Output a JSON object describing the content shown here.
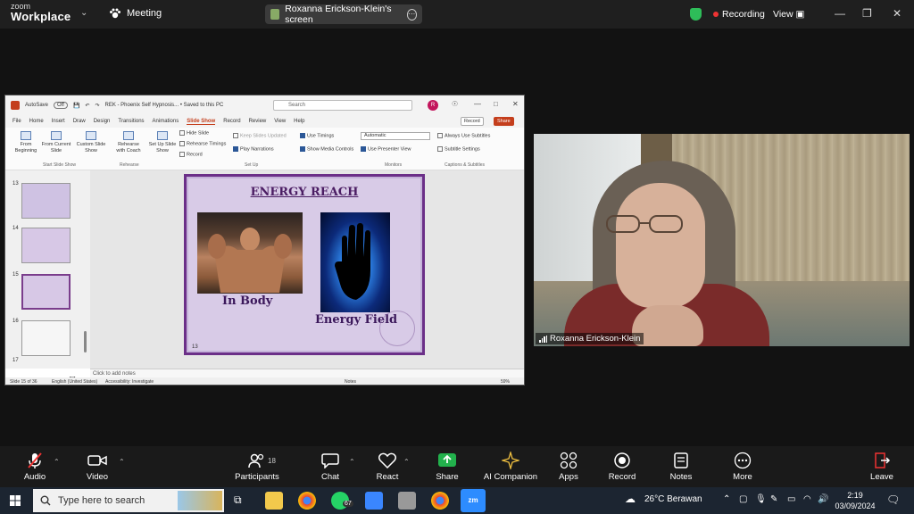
{
  "app": {
    "brand_line1": "zoom",
    "brand_line2": "Workplace",
    "meeting_label": "Meeting"
  },
  "share_pill": {
    "label": "Roxanna Erickson-Klein's screen"
  },
  "status": {
    "recording": "Recording",
    "view": "View"
  },
  "ppt": {
    "autosave": "AutoSave",
    "autosave_state": "Off",
    "doc_title": "REK - Phoenix Self Hypnosis... • Saved to this PC",
    "search_placeholder": "Search",
    "user_initial": "R",
    "menu": [
      "File",
      "Home",
      "Insert",
      "Draw",
      "Design",
      "Transitions",
      "Animations",
      "Slide Show",
      "Record",
      "Review",
      "View",
      "Help"
    ],
    "active_menu": "Slide Show",
    "record_btn": "Record",
    "share_btn": "Share",
    "ribbon": {
      "from_beginning": "From Beginning",
      "from_current": "From Current Slide",
      "custom_show": "Custom Slide Show",
      "rehearse_coach": "Rehearse with Coach",
      "setup_show": "Set Up Slide Show",
      "hide_slide": "Hide Slide",
      "rehearse_timings": "Rehearse Timings",
      "record": "Record",
      "play_from_start": "Keep Slides Updated",
      "play_narrations": "Play Narrations",
      "use_timings": "Use Timings",
      "show_media": "Show Media Controls",
      "monitor": "Automatic",
      "presenter_view": "Use Presenter View",
      "always_subtitles": "Always Use Subtitles",
      "subtitle_settings": "Subtitle Settings",
      "grp_start": "Start Slide Show",
      "grp_rehearse": "Rehearse",
      "grp_setup": "Set Up",
      "grp_monitors": "Monitors",
      "grp_captions": "Captions & Subtitles"
    },
    "thumb_numbers": [
      "13",
      "14",
      "15",
      "16",
      "17"
    ],
    "slide": {
      "title": "ENERGY REACH",
      "label_left": "In Body",
      "label_right": "Energy Field",
      "number": "13"
    },
    "notes_placeholder": "Click to add notes",
    "status_slide": "Slide 15 of 36",
    "status_lang": "English (United States)",
    "status_access": "Accessibility: Investigate",
    "status_notes": "Notes",
    "status_zoom": "59%"
  },
  "video": {
    "participant": "Roxanna Erickson-Klein"
  },
  "toolbar": {
    "audio": "Audio",
    "video": "Video",
    "participants": "Participants",
    "participants_count": "18",
    "chat": "Chat",
    "react": "React",
    "share": "Share",
    "ai": "AI Companion",
    "apps": "Apps",
    "record": "Record",
    "notes": "Notes",
    "more": "More",
    "leave": "Leave"
  },
  "taskbar": {
    "search_placeholder": "Type here to search",
    "whatsapp_badge": "67",
    "weather": "26°C  Berawan",
    "time": "2:19",
    "date": "03/09/2024"
  },
  "colors": {
    "accent_ppt": "#c43e1c",
    "slide_purple": "#6b2f88",
    "share_green": "#22b14c",
    "recording_red": "#e33333"
  }
}
